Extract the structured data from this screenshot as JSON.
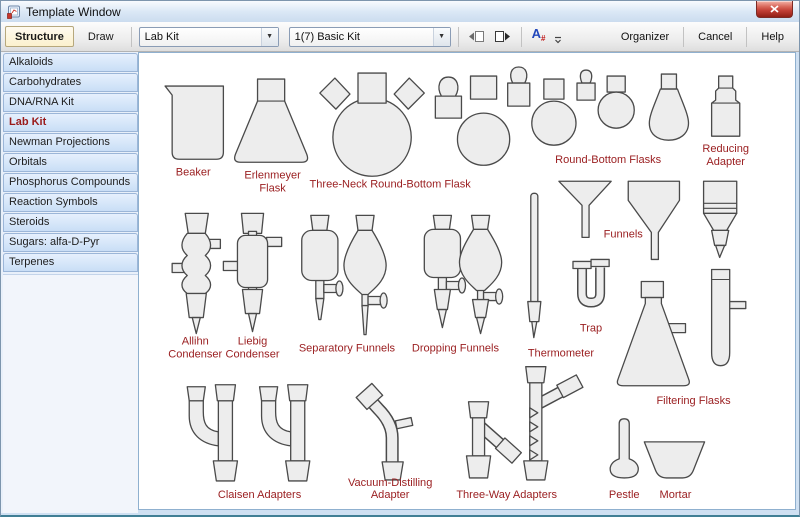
{
  "window": {
    "title": "Template Window"
  },
  "toolbar": {
    "structure_label": "Structure",
    "draw_label": "Draw",
    "template_select_value": "Lab Kit",
    "page_select_value": "1(7) Basic Kit",
    "atom_number_label": "A",
    "atom_number_sub": "#",
    "organizer_label": "Organizer",
    "cancel_label": "Cancel",
    "help_label": "Help"
  },
  "sidebar": {
    "items": [
      {
        "label": "Alkaloids",
        "selected": false
      },
      {
        "label": "Carbohydrates",
        "selected": false
      },
      {
        "label": "DNA/RNA Kit",
        "selected": false
      },
      {
        "label": "Lab Kit",
        "selected": true
      },
      {
        "label": "Newman Projections",
        "selected": false
      },
      {
        "label": "Orbitals",
        "selected": false
      },
      {
        "label": "Phosphorus Compounds",
        "selected": false
      },
      {
        "label": "Reaction Symbols",
        "selected": false
      },
      {
        "label": "Steroids",
        "selected": false
      },
      {
        "label": "Sugars: alfa-D-Pyr",
        "selected": false
      },
      {
        "label": "Terpenes",
        "selected": false
      }
    ]
  },
  "canvas": {
    "labels": {
      "beaker": "Beaker",
      "erlenmeyer_1": "Erlenmeyer",
      "erlenmeyer_2": "Flask",
      "three_neck": "Three-Neck Round-Bottom Flask",
      "round_bottom": "Round-Bottom Flasks",
      "reducing_1": "Reducing",
      "reducing_2": "Adapter",
      "allihn_1": "Allihn",
      "allihn_2": "Condenser",
      "liebig_1": "Liebig",
      "liebig_2": "Condenser",
      "separatory": "Separatory Funnels",
      "dropping": "Dropping Funnels",
      "thermometer": "Thermometer",
      "funnels": "Funnels",
      "trap": "Trap",
      "filtering": "Filtering Flasks",
      "claisen": "Claisen Adapters",
      "vacuum_1": "Vacuum-Distilling",
      "vacuum_2": "Adapter",
      "three_way": "Three-Way Adapters",
      "pestle": "Pestle",
      "mortar": "Mortar"
    }
  },
  "colors": {
    "label_maroon": "#9b2022",
    "selected_tab_red": "#9a1a1a",
    "glass_fill": "#ededed",
    "glass_stroke": "#4a4a4a",
    "structure_button_bg": "#fcf1cd",
    "sidebar_item_bg": "#c9def6",
    "close_button_red": "#c23e34"
  }
}
